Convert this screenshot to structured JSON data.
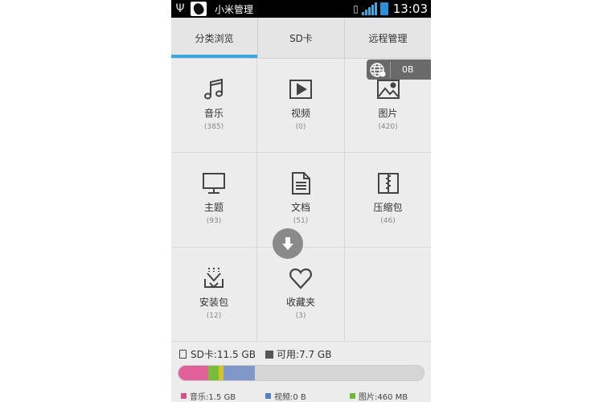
{
  "status_bar": {
    "app_title": "小米管理",
    "time": "13:03"
  },
  "tabs": [
    {
      "label": "分类浏览",
      "active": true
    },
    {
      "label": "SD卡",
      "active": false
    },
    {
      "label": "远程管理",
      "active": false
    }
  ],
  "remote_badge": {
    "value": "0B",
    "icon": "globe-icon"
  },
  "categories": [
    {
      "label": "音乐",
      "count": "(385)",
      "icon": "music-note-icon"
    },
    {
      "label": "视频",
      "count": "(0)",
      "icon": "play-icon"
    },
    {
      "label": "图片",
      "count": "(420)",
      "icon": "picture-icon"
    },
    {
      "label": "主题",
      "count": "(93)",
      "icon": "monitor-icon"
    },
    {
      "label": "文档",
      "count": "(51)",
      "icon": "document-icon"
    },
    {
      "label": "压缩包",
      "count": "(46)",
      "icon": "archive-icon"
    },
    {
      "label": "安装包",
      "count": "(12)",
      "icon": "install-package-icon"
    },
    {
      "label": "收藏夹",
      "count": "(3)",
      "icon": "heart-icon"
    }
  ],
  "storage": {
    "sd_total": "SD卡:11.5 GB",
    "available": "可用:7.7 GB",
    "usage_segments": [
      {
        "name": "音乐",
        "fraction": 0.12,
        "color": "#e2609a"
      },
      {
        "name": "图片",
        "fraction": 0.045,
        "color": "#78bc3c"
      },
      {
        "name": "other-1",
        "fraction": 0.02,
        "color": "#d3c12e"
      },
      {
        "name": "视频",
        "fraction": 0.125,
        "color": "#7f98c9"
      }
    ],
    "legend": [
      {
        "label": "音乐:1.5 GB",
        "color": "#d9508a"
      },
      {
        "label": "视频:0 B",
        "color": "#4f83c4"
      },
      {
        "label": "图片:460 MB",
        "color": "#6dba3a"
      }
    ]
  },
  "colors": {
    "accent": "#3aa7e0"
  }
}
